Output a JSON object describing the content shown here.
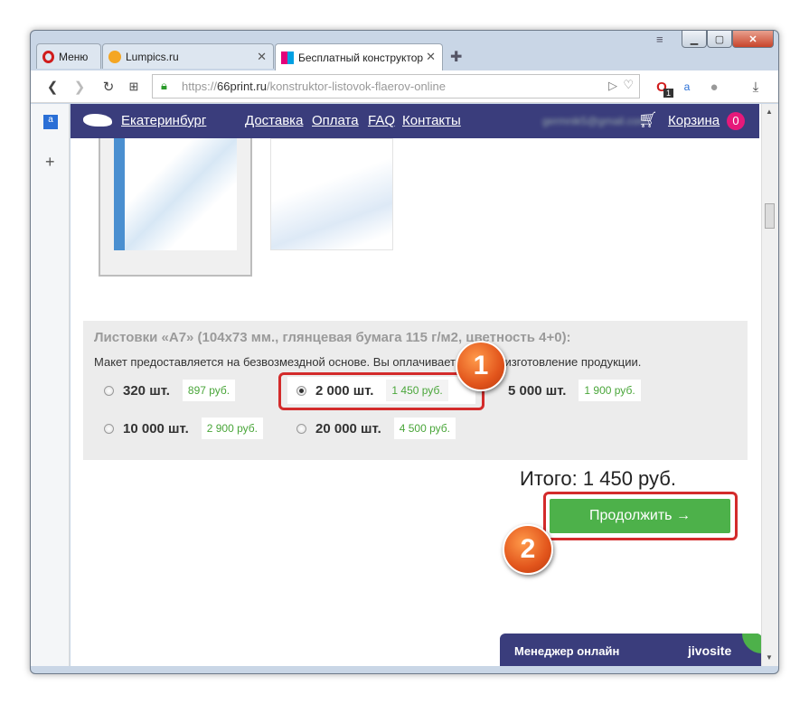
{
  "browser": {
    "tabs": [
      {
        "label": "Меню"
      },
      {
        "label": "Lumpics.ru"
      },
      {
        "label": "Бесплатный конструктор"
      }
    ],
    "url_prefix": "https://",
    "url_domain": "66print.ru",
    "url_path": "/konstruktor-listovok-flaerov-online",
    "badge_count": "1"
  },
  "site": {
    "city": "Екатеринбург",
    "nav": [
      "Доставка",
      "Оплата",
      "FAQ",
      "Контакты"
    ],
    "email": "germnik5@gmail.com",
    "cart_label": "Корзина",
    "cart_count": "0"
  },
  "order": {
    "title": "Листовки «А7» (104х73 мм., глянцевая бумага 115 г/м2, цветность 4+0):",
    "desc": "Макет предоставляется на безвозмездной основе. Вы оплачиваете только изготовление продукции.",
    "options": [
      {
        "qty": "320 шт.",
        "price": "897 руб.",
        "selected": false
      },
      {
        "qty": "2 000 шт.",
        "price": "1 450 руб.",
        "selected": true
      },
      {
        "qty": "5 000 шт.",
        "price": "1 900 руб.",
        "selected": false
      },
      {
        "qty": "10 000 шт.",
        "price": "2 900 руб.",
        "selected": false
      },
      {
        "qty": "20 000 шт.",
        "price": "4 500 руб.",
        "selected": false
      }
    ],
    "total": "Итого: 1 450 руб.",
    "continue_label": "Продолжить →"
  },
  "annotations": {
    "step1": "1",
    "step2": "2"
  },
  "chat": {
    "label": "Менеджер онлайн",
    "brand": "jivosite"
  },
  "colors": {
    "nav_bg": "#3a3d7c",
    "green": "#4db14a",
    "annotation_red": "#d32b2b",
    "price_green": "#4aa63a"
  }
}
